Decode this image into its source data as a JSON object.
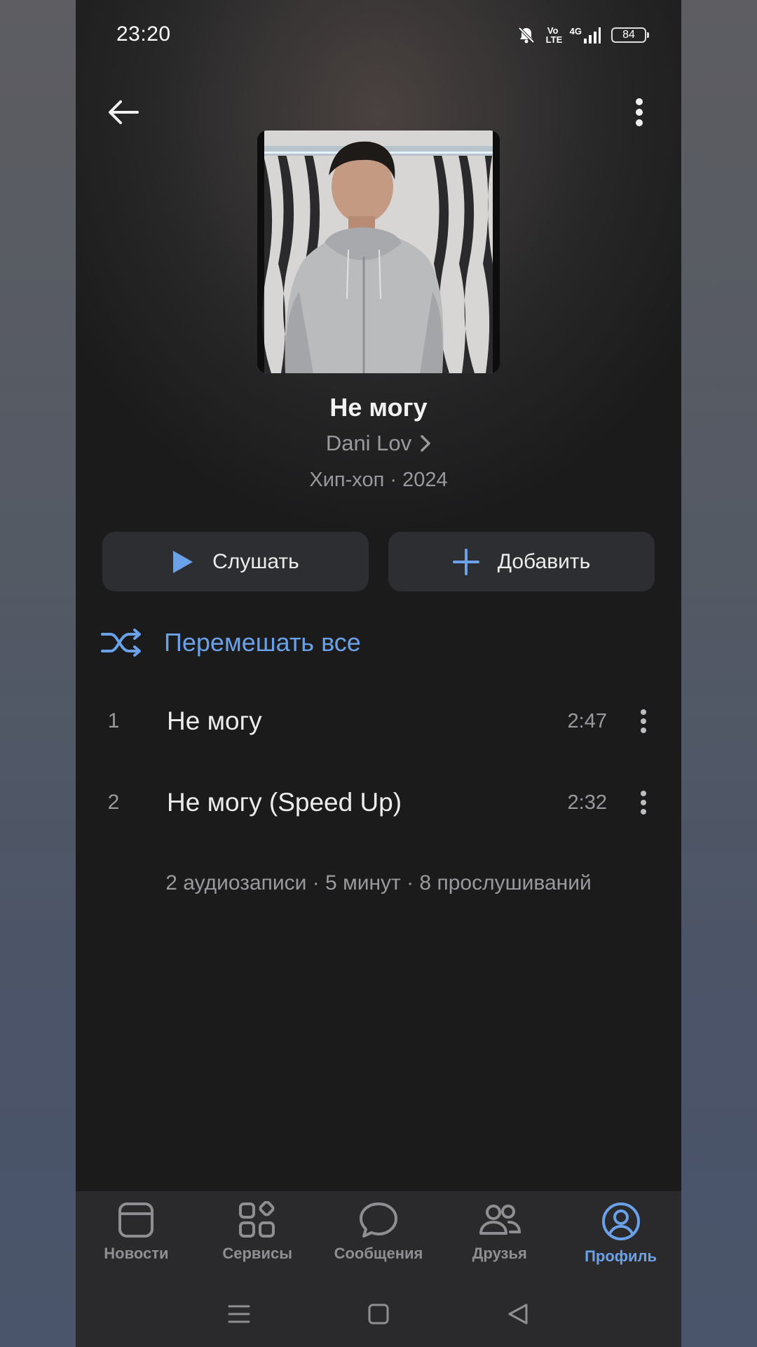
{
  "status_bar": {
    "time": "23:20",
    "network": "4G",
    "volte": "Vo LTE",
    "battery": "84"
  },
  "album": {
    "title": "Не могу",
    "artist": "Dani Lov",
    "meta": "Хип-хоп · 2024"
  },
  "actions": {
    "listen_label": "Слушать",
    "add_label": "Добавить",
    "shuffle_label": "Перемешать все"
  },
  "tracks": [
    {
      "num": "1",
      "title": "Не могу",
      "duration": "2:47"
    },
    {
      "num": "2",
      "title": "Не могу (Speed Up)",
      "duration": "2:32"
    }
  ],
  "summary": "2 аудиозаписи · 5 минут · 8 прослушиваний",
  "bottom_nav": {
    "items": [
      {
        "label": "Новости",
        "icon": "news-icon"
      },
      {
        "label": "Сервисы",
        "icon": "services-icon"
      },
      {
        "label": "Сообщения",
        "icon": "messages-icon"
      },
      {
        "label": "Друзья",
        "icon": "friends-icon"
      },
      {
        "label": "Профиль",
        "icon": "profile-icon"
      }
    ],
    "active": "Профиль"
  },
  "colors": {
    "accent": "#6aa1e8",
    "background": "#1b1b1c",
    "button_bg": "#2d2e31",
    "nav_bg": "#2a2a2c"
  }
}
